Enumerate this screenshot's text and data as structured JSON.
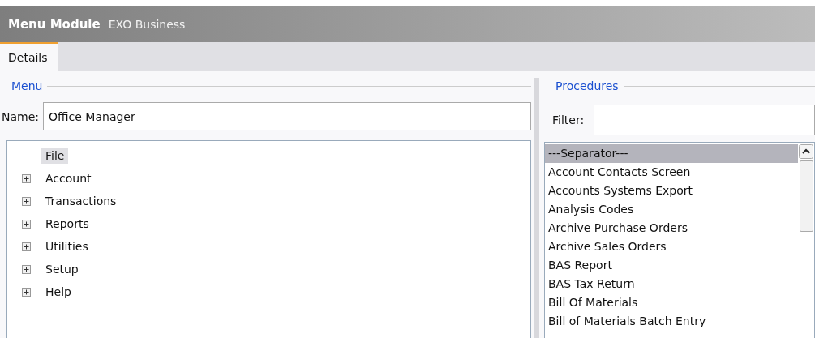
{
  "window": {
    "title": "Menu Module",
    "subtitle": "EXO Business"
  },
  "tabs": [
    {
      "label": "Details",
      "selected": true
    }
  ],
  "menu": {
    "legend": "Menu",
    "name_label": "Name:",
    "name_value": "Office Manager",
    "tree": [
      {
        "label": "File",
        "kind": "leaf",
        "selected": true
      },
      {
        "label": "Account",
        "kind": "node",
        "expanded": false,
        "selected": false
      },
      {
        "label": "Transactions",
        "kind": "node",
        "expanded": false,
        "selected": false
      },
      {
        "label": "Reports",
        "kind": "node",
        "expanded": false,
        "selected": false
      },
      {
        "label": "Utilities",
        "kind": "node",
        "expanded": false,
        "selected": false
      },
      {
        "label": "Setup",
        "kind": "node",
        "expanded": false,
        "selected": false
      },
      {
        "label": "Help",
        "kind": "node",
        "expanded": false,
        "selected": false
      }
    ]
  },
  "procedures": {
    "legend": "Procedures",
    "filter_label": "Filter:",
    "items": [
      {
        "label": "---Separator---",
        "selected": true
      },
      {
        "label": "Account Contacts Screen",
        "selected": false
      },
      {
        "label": "Accounts Systems Export",
        "selected": false
      },
      {
        "label": "Analysis Codes",
        "selected": false
      },
      {
        "label": "Archive Purchase Orders",
        "selected": false
      },
      {
        "label": "Archive Sales Orders",
        "selected": false
      },
      {
        "label": "BAS Report",
        "selected": false
      },
      {
        "label": "BAS Tax Return",
        "selected": false
      },
      {
        "label": "Bill Of Materials",
        "selected": false
      },
      {
        "label": "Bill of Materials Batch Entry",
        "selected": false
      }
    ]
  }
}
